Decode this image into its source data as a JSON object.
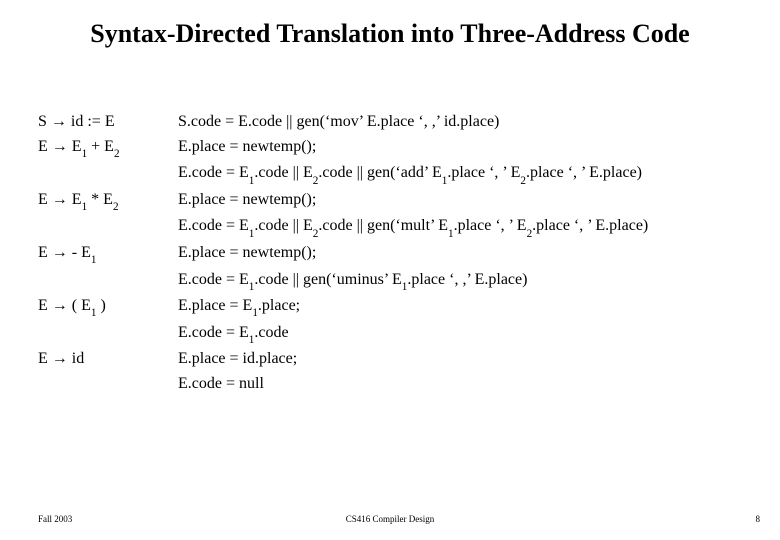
{
  "title": "Syntax-Directed Translation into Three-Address Code",
  "rules": [
    {
      "lhs": "S → id := E",
      "rhs": [
        "S.code = E.code || gen('mov' E.place ', ,' id.place)"
      ]
    },
    {
      "lhs": "E → E₁ + E₂",
      "rhs": [
        "E.place = newtemp();",
        "E.code = E₁.code || E₂.code || gen('add' E₁.place ', ' E₂.place ', ' E.place)"
      ]
    },
    {
      "lhs": "E → E₁ * E₂",
      "rhs": [
        "E.place = newtemp();",
        "E.code = E₁.code || E₂.code || gen('mult' E₁.place ', ' E₂.place ', ' E.place)"
      ]
    },
    {
      "lhs": "E → - E₁",
      "rhs": [
        "E.place = newtemp();",
        "E.code = E₁.code || gen('uminus' E₁.place ', ,' E.place)"
      ]
    },
    {
      "lhs": "E → ( E₁ )",
      "rhs": [
        "E.place = E₁.place;",
        "E.code = E₁.code"
      ]
    },
    {
      "lhs": "E → id",
      "rhs": [
        "E.place = id.place;",
        "E.code = null"
      ]
    }
  ],
  "footer": {
    "left": "Fall 2003",
    "center": "CS416 Compiler Design",
    "right": "8"
  }
}
